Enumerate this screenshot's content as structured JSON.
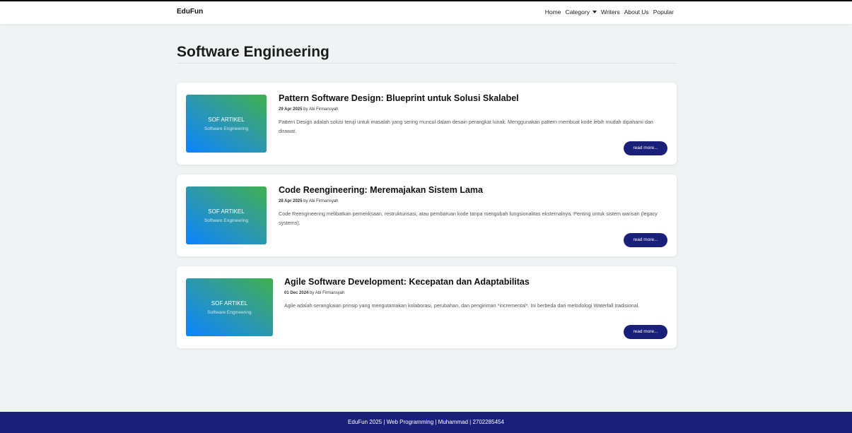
{
  "navbar": {
    "brand": "EduFun",
    "links": [
      "Home",
      "Category",
      "Writers",
      "About Us",
      "Popular"
    ]
  },
  "page": {
    "title": "Software Engineering"
  },
  "articles": [
    {
      "thumb_title": "SOF ARTIKEL",
      "thumb_sub": "Software Engineering",
      "title": "Pattern Software Design: Blueprint untuk Solusi Skalabel",
      "date": "29 Apr 2025",
      "by_label": "by",
      "author": "Abi Firmansyah",
      "desc": "Pattern Design adalah solusi teruji untuk masalah yang sering muncul dalam desain perangkat lunak. Menggunakan pattern membuat kode lebih mudah dipahami dan dirawat.",
      "button": "read more..."
    },
    {
      "thumb_title": "SOF ARTIKEL",
      "thumb_sub": "Software Engineering",
      "title": "Code Reengineering: Meremajakan Sistem Lama",
      "date": "28 Apr 2025",
      "by_label": "by",
      "author": "Abi Firmansyah",
      "desc": "Code Reengineering melibatkan pemeriksaan, restrukturisasi, atau pembaruan kode tanpa mengubah fungsionalitas eksternalnya. Penting untuk sistem warisan (legacy systems).",
      "button": "read more..."
    },
    {
      "thumb_title": "SOF ARTIKEL",
      "thumb_sub": "Software Engineering",
      "title": "Agile Software Development: Kecepatan dan Adaptabilitas",
      "date": "01 Dec 2024",
      "by_label": "by",
      "author": "Abi Firmansyah",
      "desc": "Agile adalah serangkaian prinsip yang mengutamakan kolaborasi, perubahan, dan pengiriman *incremental*. Ini berbeda dari metodologi Waterfall tradisional.",
      "button": "read more..."
    }
  ],
  "footer": {
    "text": "EduFun 2025 | Web Programming | Muhammad | 2702285454"
  },
  "colors": {
    "accent": "#1a1f7a",
    "background": "#eff3f3"
  }
}
